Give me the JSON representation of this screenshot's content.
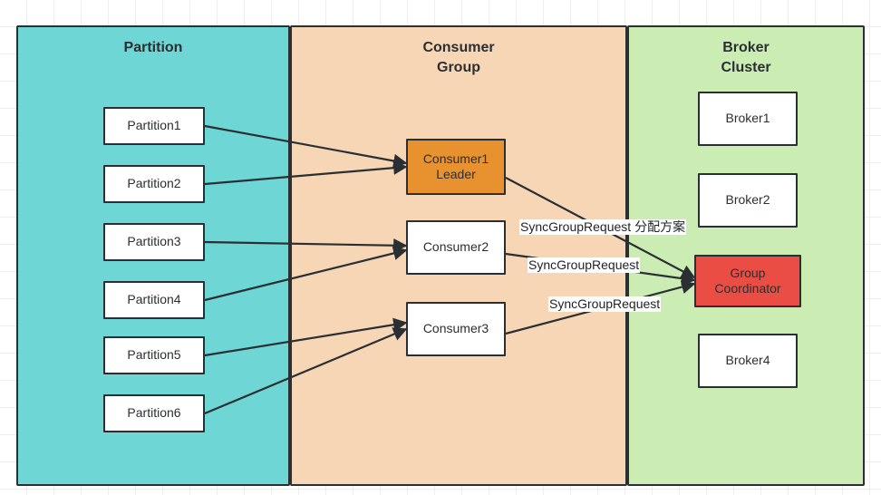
{
  "diagram": {
    "title": "Kafka Consumer Group SyncGroupRequest flow",
    "colors": {
      "partition_panel": "#6FD6D6",
      "consumer_panel": "#F7D6B6",
      "broker_panel": "#CBEDB4",
      "leader_box": "#E8912F",
      "coordinator_box": "#EA4D44",
      "node_box": "#FFFFFF",
      "stroke": "#2A2F33",
      "grid": "#EEEEEE"
    }
  },
  "panels": {
    "partition": {
      "title": "Partition"
    },
    "consumer": {
      "title": "Consumer\nGroup"
    },
    "broker": {
      "title": "Broker\nCluster"
    }
  },
  "partitions": [
    {
      "label": "Partition1"
    },
    {
      "label": "Partition2"
    },
    {
      "label": "Partition3"
    },
    {
      "label": "Partition4"
    },
    {
      "label": "Partition5"
    },
    {
      "label": "Partition6"
    }
  ],
  "consumers": [
    {
      "label": "Consumer1\nLeader",
      "role": "leader"
    },
    {
      "label": "Consumer2",
      "role": "member"
    },
    {
      "label": "Consumer3",
      "role": "member"
    }
  ],
  "brokers": [
    {
      "label": "Broker1",
      "role": "broker"
    },
    {
      "label": "Broker2",
      "role": "broker"
    },
    {
      "label": "Group\nCoordinator",
      "role": "coordinator"
    },
    {
      "label": "Broker4",
      "role": "broker"
    }
  ],
  "edge_labels": [
    {
      "text": "SyncGroupRequest 分配方案"
    },
    {
      "text": "SyncGroupRequest"
    },
    {
      "text": "SyncGroupRequest"
    }
  ]
}
